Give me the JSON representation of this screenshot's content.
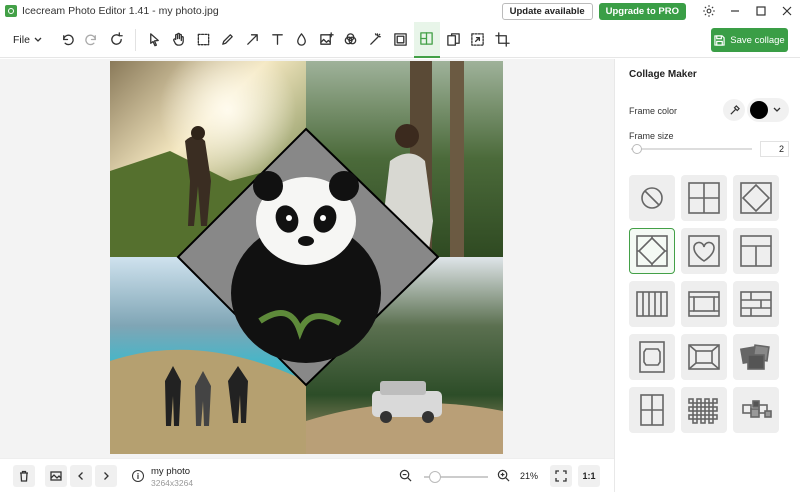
{
  "window": {
    "title": "Icecream Photo Editor 1.41 - my photo.jpg",
    "update_label": "Update available",
    "pro_label": "Upgrade to PRO"
  },
  "toolbar": {
    "file_label": "File",
    "save_label": "Save collage",
    "active_tool": "collage"
  },
  "panel": {
    "title": "Collage Maker",
    "frame_color_label": "Frame color",
    "frame_color": "#000000",
    "frame_size_label": "Frame size",
    "frame_size_value": "2"
  },
  "statusbar": {
    "file_name": "my photo",
    "file_dims": "3264x3264",
    "zoom_value": "21%",
    "one_to_one": "1:1"
  },
  "colors": {
    "accent": "#43a047",
    "brand_green": "#3a9e46"
  }
}
